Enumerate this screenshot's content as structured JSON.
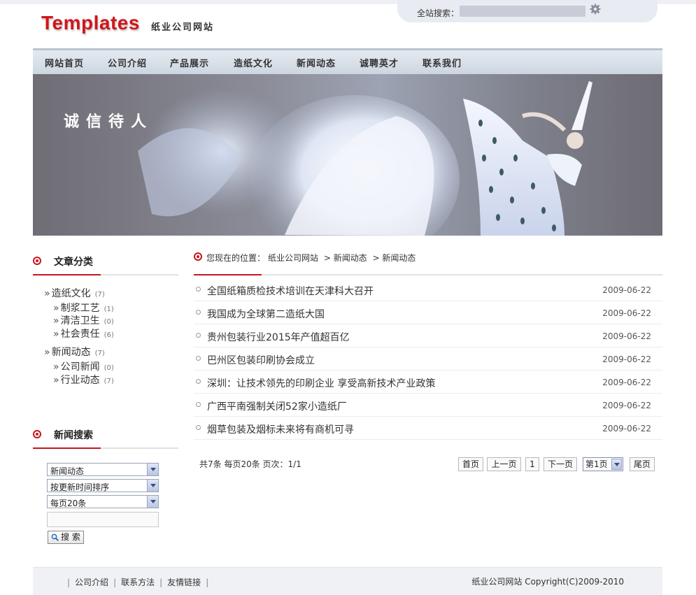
{
  "top": {
    "search_label": "全站搜索：",
    "search_placeholder": ""
  },
  "logo": {
    "title": "Templates",
    "subtitle": "纸业公司网站"
  },
  "nav": {
    "items": [
      {
        "label": "网站首页"
      },
      {
        "label": "公司介绍"
      },
      {
        "label": "产品展示"
      },
      {
        "label": "造纸文化"
      },
      {
        "label": "新闻动态",
        "active": true
      },
      {
        "label": "诚聘英才"
      },
      {
        "label": "联系我们"
      }
    ]
  },
  "banner": {
    "title": "诚信待人"
  },
  "sidebar": {
    "categories_title": "文章分类",
    "categories": [
      {
        "label": "造纸文化",
        "count": "(7)"
      },
      {
        "label": "制浆工艺",
        "count": "(1)"
      },
      {
        "label": "清洁卫生",
        "count": "(0)"
      },
      {
        "label": "社会责任",
        "count": "(6)"
      },
      {
        "label": "新闻动态",
        "count": "(7)"
      },
      {
        "label": "公司新闻",
        "count": "(0)"
      },
      {
        "label": "行业动态",
        "count": "(7)"
      }
    ],
    "search_title": "新闻搜索",
    "search_selects": [
      "新闻动态",
      "按更新时间排序",
      "每页20条"
    ],
    "search_button": "搜 索"
  },
  "breadcrumb": {
    "prefix": "您现在的位置：",
    "items": [
      "纸业公司网站",
      "> 新闻动态",
      "> 新闻动态"
    ]
  },
  "news": [
    {
      "title": "全国纸箱质检技术培训在天津科大召开",
      "date": "2009-06-22"
    },
    {
      "title": "我国成为全球第二造纸大国",
      "date": "2009-06-22"
    },
    {
      "title": "贵州包装行业2015年产值超百亿",
      "date": "2009-06-22"
    },
    {
      "title": "巴州区包装印刷协会成立",
      "date": "2009-06-22"
    },
    {
      "title": "深圳：让技术领先的印刷企业 享受高新技术产业政策",
      "date": "2009-06-22"
    },
    {
      "title": "广西平南强制关闭52家小造纸厂",
      "date": "2009-06-22"
    },
    {
      "title": "烟草包装及烟标未来将有商机可寻",
      "date": "2009-06-22"
    }
  ],
  "pagination": {
    "info": "共7条 每页20条 页次：1/1",
    "first": "首页",
    "prev": "上一页",
    "current": "1",
    "next": "下一页",
    "page_select": "第1页",
    "last": "尾页"
  },
  "footer": {
    "links": [
      "公司介绍",
      "联系方法",
      "友情链接"
    ],
    "copyright": "纸业公司网站  Copyright(C)2009-2010"
  },
  "colors": {
    "accent": "#c5161c",
    "nav_bg": "#d7dee7"
  }
}
